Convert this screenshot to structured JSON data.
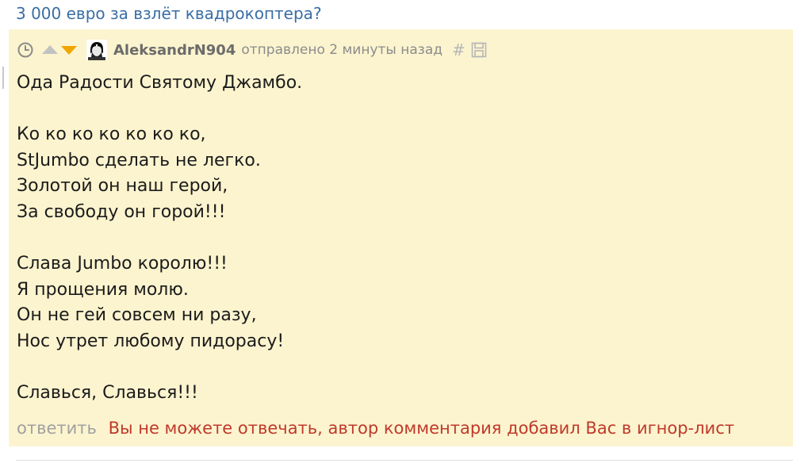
{
  "parent_link": {
    "text": "3 000 евро за взлёт квадрокоптера?"
  },
  "comment": {
    "icons": {
      "clock": "clock-icon",
      "upvote": "arrow-up-icon",
      "downvote": "arrow-down-icon",
      "avatar": "avatar",
      "hash": "hash-icon",
      "save": "save-icon"
    },
    "author": "AleksandrN904",
    "sent": "отправлено 2 минуты назад",
    "hash_symbol": "#",
    "lines": [
      "Ода Радости Святому Джамбо.",
      "",
      "Ко ко ко ко ко ко ко,",
      "StJumbo сделать не легко.",
      "Золотой он наш герой,",
      "За свободу он горой!!!",
      "",
      "Слава Jumbo королю!!!",
      "Я прощения молю.",
      "Он не гей совсем ни разу,",
      "Нос утрет любому пидорасу!",
      "",
      "Славься, Славься!!!"
    ],
    "reply_label": "ответить",
    "ignore_notice": "Вы не можете отвечать, автор комментария добавил Вас в игнор-лист"
  },
  "colors": {
    "link": "#3a6ea5",
    "comment_background": "#fcf4cf",
    "notice": "#c0392b",
    "upvote": "#c2c2c2",
    "downvote": "#f0a500"
  }
}
